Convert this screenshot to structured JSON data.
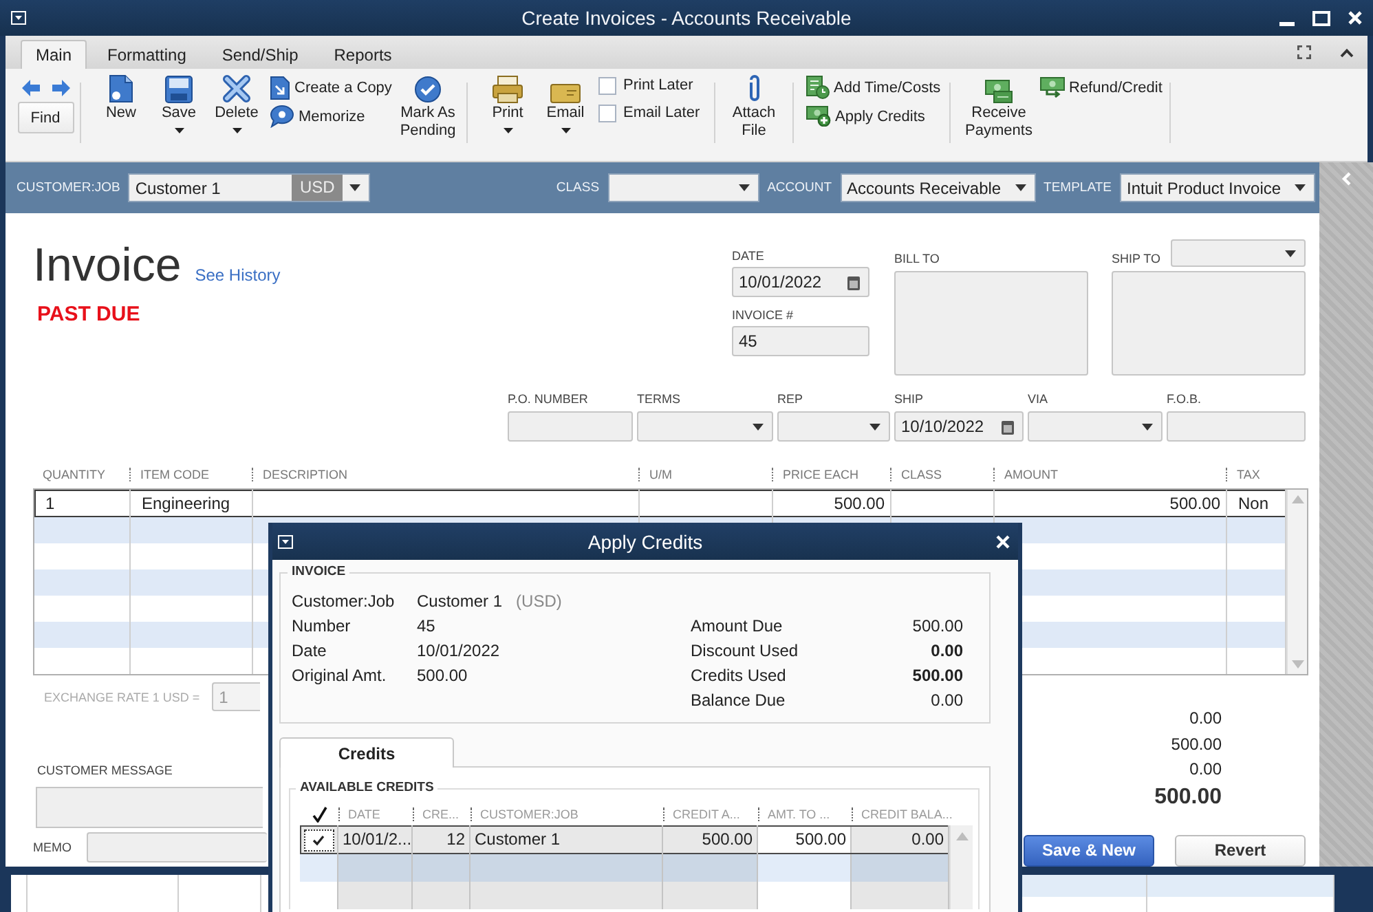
{
  "window": {
    "title": "Create Invoices - Accounts Receivable"
  },
  "ribbon_tabs": [
    {
      "label": "Main",
      "selected": true
    },
    {
      "label": "Formatting",
      "selected": false
    },
    {
      "label": "Send/Ship",
      "selected": false
    },
    {
      "label": "Reports",
      "selected": false
    }
  ],
  "toolbar": {
    "find": "Find",
    "new": "New",
    "save": "Save",
    "delete": "Delete",
    "create_copy": "Create a Copy",
    "memorize": "Memorize",
    "mark_as_pending": "Mark As Pending",
    "print": "Print",
    "email": "Email",
    "print_later": {
      "label": "Print Later",
      "checked": false
    },
    "email_later": {
      "label": "Email Later",
      "checked": false
    },
    "attach_file": "Attach File",
    "add_time_costs": "Add Time/Costs",
    "apply_credits": "Apply Credits",
    "receive_payments": "Receive Payments",
    "refund_credit": "Refund/Credit"
  },
  "header": {
    "customer_job": {
      "label": "CUSTOMER:JOB",
      "value": "Customer 1",
      "currency": "USD"
    },
    "class": {
      "label": "CLASS"
    },
    "account": {
      "label": "ACCOUNT",
      "value": "Accounts Receivable"
    },
    "template": {
      "label": "TEMPLATE",
      "value": "Intuit Product Invoice"
    }
  },
  "invoice": {
    "title": "Invoice",
    "history_link": "See History",
    "status": "PAST DUE",
    "date": {
      "label": "DATE",
      "value": "10/01/2022"
    },
    "number": {
      "label": "INVOICE #",
      "value": "45"
    },
    "bill_to": {
      "label": "BILL TO"
    },
    "ship_to": {
      "label": "SHIP TO"
    },
    "fields": [
      {
        "label": "P.O. NUMBER",
        "kind": "text"
      },
      {
        "label": "TERMS",
        "kind": "dropdown"
      },
      {
        "label": "REP",
        "kind": "dropdown"
      },
      {
        "label": "SHIP",
        "kind": "date",
        "value": "10/10/2022"
      },
      {
        "label": "VIA",
        "kind": "dropdown"
      },
      {
        "label": "F.O.B.",
        "kind": "text"
      }
    ]
  },
  "lines": {
    "columns": [
      "QUANTITY",
      "ITEM CODE",
      "DESCRIPTION",
      "U/M",
      "PRICE EACH",
      "CLASS",
      "AMOUNT",
      "TAX"
    ],
    "rows": [
      {
        "quantity": "1",
        "item_code": "Engineering",
        "price_each": "500.00",
        "amount": "500.00",
        "tax": "Non"
      }
    ]
  },
  "exchange_rate": {
    "label": "EXCHANGE RATE 1 USD =",
    "value": "1",
    "disabled": true
  },
  "totals": [
    {
      "value": "0.00",
      "kind": "amount"
    },
    {
      "value": "500.00",
      "kind": "amount"
    },
    {
      "value": "0.00",
      "kind": "amount"
    },
    {
      "value": "500.00",
      "kind": "total"
    }
  ],
  "customer_message": {
    "label": "CUSTOMER MESSAGE"
  },
  "memo": {
    "label": "MEMO"
  },
  "buttons": [
    {
      "label": "Save & New",
      "kind": "primary"
    },
    {
      "label": "Revert",
      "kind": "secondary"
    }
  ],
  "apply_credits_dialog": {
    "title": "Apply Credits",
    "invoice": {
      "legend": "INVOICE",
      "customer_job": {
        "label": "Customer:Job",
        "value": "Customer 1",
        "currency": "(USD)"
      },
      "details": [
        {
          "label": "Number",
          "value": "45"
        },
        {
          "label": "Date",
          "value": "10/01/2022"
        },
        {
          "label": "Original Amt.",
          "value": "500.00"
        }
      ],
      "amounts": [
        {
          "label": "Amount Due",
          "value": "500.00",
          "bold": false
        },
        {
          "label": "Discount Used",
          "value": "0.00",
          "bold": true
        },
        {
          "label": "Credits Used",
          "value": "500.00",
          "bold": true
        },
        {
          "label": "Balance Due",
          "value": "0.00",
          "bold": false
        }
      ]
    },
    "tabs": [
      {
        "label": "Credits",
        "selected": true
      }
    ],
    "available_credits": {
      "legend": "AVAILABLE CREDITS",
      "columns": [
        "DATE",
        "CRE...",
        "CUSTOMER:JOB",
        "CREDIT A...",
        "AMT. TO ...",
        "CREDIT BALA..."
      ],
      "rows": [
        {
          "checked": true,
          "cells": [
            "10/01/2...",
            "12",
            "Customer 1",
            "500.00",
            "500.00",
            "0.00"
          ]
        }
      ]
    }
  }
}
